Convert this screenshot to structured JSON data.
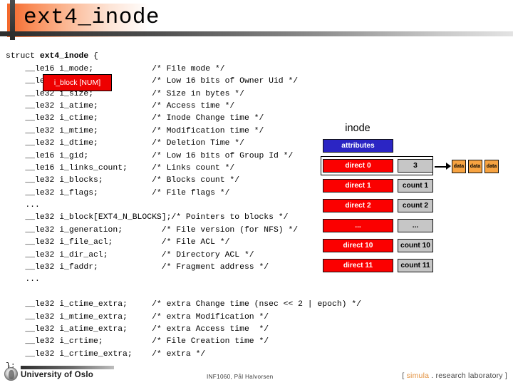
{
  "slide": {
    "title": "ext4_inode",
    "accent_orange": "#f4672a",
    "accent_blue": "#2b25c4",
    "accent_red": "#fb0000",
    "accent_gray": "#c6c6c6",
    "accent_data": "#f7a341"
  },
  "code": {
    "lines": [
      "struct <b>ext4_inode</b> {",
      "    __le16 i_mode;            /* File mode */",
      "    __le16 i_uid;             /* Low 16 bits of Owner Uid */",
      "    __le32 i_size;            /* Size in bytes */",
      "    __le32 i_atime;           /* Access time */",
      "    __le32 i_ctime;           /* Inode Change time */",
      "    __le32 i_mtime;           /* Modification time */",
      "    __le32 i_dtime;           /* Deletion Time */",
      "    __le16 i_gid;             /* Low 16 bits of Group Id */",
      "    __le16 i_links_count;     /* Links count */",
      "    __le32 i_blocks;          /* Blocks count */",
      "    __le32 i_flags;           /* File flags */",
      "    ...",
      "    __le32 i_block[EXT4_N_BLOCKS];/* Pointers to blocks */",
      "    __le32 i_generation;        /* File version (for NFS) */",
      "    __le32 i_file_acl;          /* File ACL */",
      "    __le32 i_dir_acl;           /* Directory ACL */",
      "    __le32 i_faddr;             /* Fragment address */",
      "    ...",
      "",
      "    __le32 i_ctime_extra;     /* extra Change time (nsec << 2 | epoch) */",
      "    __le32 i_mtime_extra;     /* extra Modification */",
      "    __le32 i_atime_extra;     /* extra Access time  */",
      "    __le32 i_crtime;          /* File Creation time */",
      "    __le32 i_crtime_extra;    /* extra */",
      "};"
    ]
  },
  "callout": {
    "i_block_label": "i_block [NUM]"
  },
  "diagram": {
    "caption": "inode",
    "attributes_label": "attributes",
    "rows": [
      {
        "pointer": "direct 0",
        "count": "3"
      },
      {
        "pointer": "direct 1",
        "count": "count 1"
      },
      {
        "pointer": "direct 2",
        "count": "count 2"
      },
      {
        "pointer": "...",
        "count": "..."
      },
      {
        "pointer": "direct 10",
        "count": "count 10"
      },
      {
        "pointer": "direct 11",
        "count": "count 11"
      }
    ],
    "data_blocks": [
      "data",
      "data",
      "data"
    ]
  },
  "footer": {
    "university": "University of Oslo",
    "course": "INF1060, Pål Halvorsen",
    "lab_open_bracket": "[ ",
    "lab_accent": "simula",
    "lab_rest": " . research laboratory ]"
  }
}
